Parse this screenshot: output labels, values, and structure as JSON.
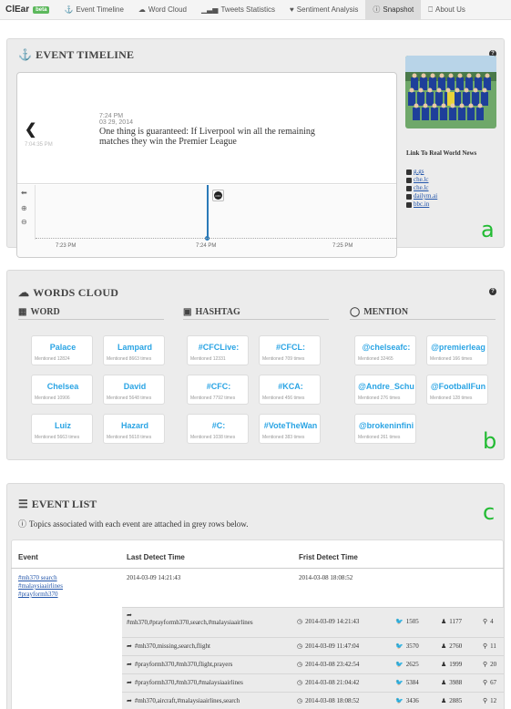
{
  "nav": {
    "brand": "ClEar",
    "badge": "beta",
    "items": [
      {
        "label": "Event Timeline",
        "icon": "anchor-icon",
        "active": false
      },
      {
        "label": "Word Cloud",
        "icon": "cloud-icon",
        "active": false
      },
      {
        "label": "Tweets Statistics",
        "icon": "bar-chart-icon",
        "active": false
      },
      {
        "label": "Sentiment Analysis",
        "icon": "heart-icon",
        "active": false
      },
      {
        "label": "Snapshot",
        "icon": "info-circle-icon",
        "active": true
      },
      {
        "label": "About Us",
        "icon": "bookmark-icon",
        "active": false
      }
    ]
  },
  "timeline": {
    "title": "EVENT TIMELINE",
    "prev_time": "7:04:35 PM",
    "event_time": "7:24 PM",
    "event_date": "03 29, 2014",
    "event_text": "One thing is guaranteed: If Liverpool win all the remaining matches they win the Premier League",
    "axis_labels": [
      "7:23 PM",
      "7:24 PM",
      "7:25 PM"
    ],
    "link_heading": "Link To Real World News",
    "links": [
      "g.gs",
      "che.lc",
      "che.lc",
      "dailym.ai",
      "bbc.in"
    ],
    "letter": "a"
  },
  "words_cloud": {
    "title": "WORDS CLOUD",
    "letter": "b",
    "columns": [
      {
        "heading": "WORD",
        "cards": [
          {
            "word": "Palace",
            "count": "Mentioned 12824"
          },
          {
            "word": "Lampard",
            "count": "Mentioned 8663 times"
          },
          {
            "word": "Chelsea",
            "count": "Mentioned 10906"
          },
          {
            "word": "David",
            "count": "Mentioned 5648 times"
          },
          {
            "word": "Luiz",
            "count": "Mentioned 5663 times"
          },
          {
            "word": "Hazard",
            "count": "Mentioned 5618 times"
          }
        ]
      },
      {
        "heading": "HASHTAG",
        "cards": [
          {
            "word": "#CFCLive:",
            "count": "Mentioned 12331"
          },
          {
            "word": "#CFCL:",
            "count": "Mentioned 709 times"
          },
          {
            "word": "#CFC:",
            "count": "Mentioned 7792 times"
          },
          {
            "word": "#KCA:",
            "count": "Mentioned 456 times"
          },
          {
            "word": "#C:",
            "count": "Mentioned 1038 times"
          },
          {
            "word": "#VoteTheWan",
            "count": "Mentioned 383 times"
          }
        ]
      },
      {
        "heading": "MENTION",
        "cards": [
          {
            "word": "@chelseafc:",
            "count": "Mentioned 32465"
          },
          {
            "word": "@premierleag",
            "count": "Mentioned 166 times"
          },
          {
            "word": "@Andre_Schu",
            "count": "Mentioned 276 times"
          },
          {
            "word": "@FootballFun",
            "count": "Mentioned 128 times"
          },
          {
            "word": "@brokeninfini",
            "count": "Mentioned 261 times"
          }
        ]
      }
    ]
  },
  "event_list": {
    "title": "EVENT LIST",
    "letter": "c",
    "subtitle": "Topics associated with each event are attached in grey rows below.",
    "headers": [
      "Event",
      "Last Detect Time",
      "Frist Detect Time"
    ],
    "event_links": [
      "#mh370 search",
      "#malaysiaairlines",
      "#prayformh370"
    ],
    "last_detect": "2014-03-09 14:21:43",
    "first_detect": "2014-03-08 18:08:52",
    "rows": [
      {
        "tags": "#mh370,#prayformh370,search,#malaysiaairlines",
        "time": "2014-03-09 14:21:43",
        "tweets": "1505",
        "users": "1177",
        "places": "4"
      },
      {
        "tags": "#mh370,missing,search,flight",
        "time": "2014-03-09 11:47:04",
        "tweets": "3570",
        "users": "2760",
        "places": "11"
      },
      {
        "tags": "#prayformh370,#mh370,flight,prayers",
        "time": "2014-03-08 23:42:54",
        "tweets": "2625",
        "users": "1999",
        "places": "20"
      },
      {
        "tags": "#prayformh370,#mh370,#malaysiaairlines",
        "time": "2014-03-08 21:04:42",
        "tweets": "5384",
        "users": "3988",
        "places": "67"
      },
      {
        "tags": "#mh370,aircraft,#malaysiaairlines,search",
        "time": "2014-03-08 18:08:52",
        "tweets": "3436",
        "users": "2885",
        "places": "12"
      }
    ]
  }
}
